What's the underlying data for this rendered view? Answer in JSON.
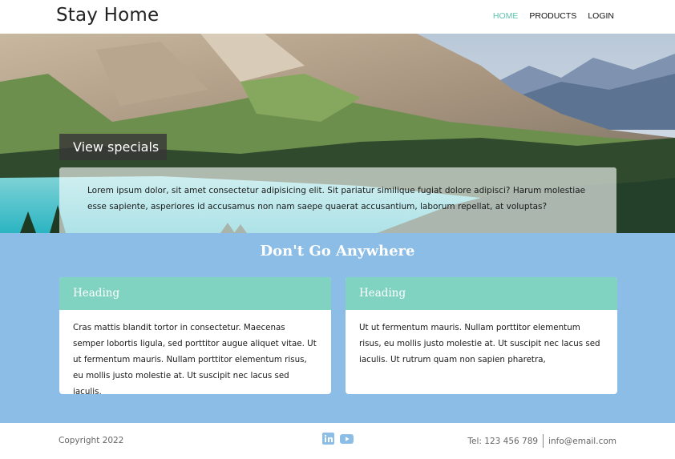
{
  "header": {
    "brand": "Stay Home",
    "nav": [
      {
        "label": "HOME",
        "active": true
      },
      {
        "label": "PRODUCTS",
        "active": false
      },
      {
        "label": "LOGIN",
        "active": false
      }
    ]
  },
  "hero": {
    "button_label": "View specials",
    "text": "Lorem ipsum dolor, sit amet consectetur adipisicing elit. Sit pariatur similique fugiat dolore adipisci? Harum molestiae esse sapiente, asperiores id accusamus non nam saepe quaerat accusantium, laborum repellat, at voluptas?"
  },
  "section": {
    "title": "Don't Go Anywhere",
    "cards": [
      {
        "heading": "Heading",
        "body": "Cras mattis blandit tortor in consectetur. Maecenas semper lobortis ligula, sed porttitor augue aliquet vitae. Ut ut fermentum mauris. Nullam porttitor elementum risus, eu mollis justo molestie at. Ut suscipit nec lacus sed iaculis."
      },
      {
        "heading": "Heading",
        "body": "Ut ut fermentum mauris. Nullam porttitor elementum risus, eu mollis justo molestie at. Ut suscipit nec lacus sed iaculis. Ut rutrum quam non sapien pharetra,"
      }
    ]
  },
  "footer": {
    "copyright": "Copyright 2022",
    "social_icons": [
      "linkedin-icon",
      "youtube-icon"
    ],
    "phone": "Tel: 123 456 789",
    "email": "info@email.com"
  },
  "colors": {
    "accent": "#5fc4ad",
    "card_header": "#80d3c1",
    "section_bg": "#8bbde6",
    "social_icon": "#8bbde6"
  }
}
